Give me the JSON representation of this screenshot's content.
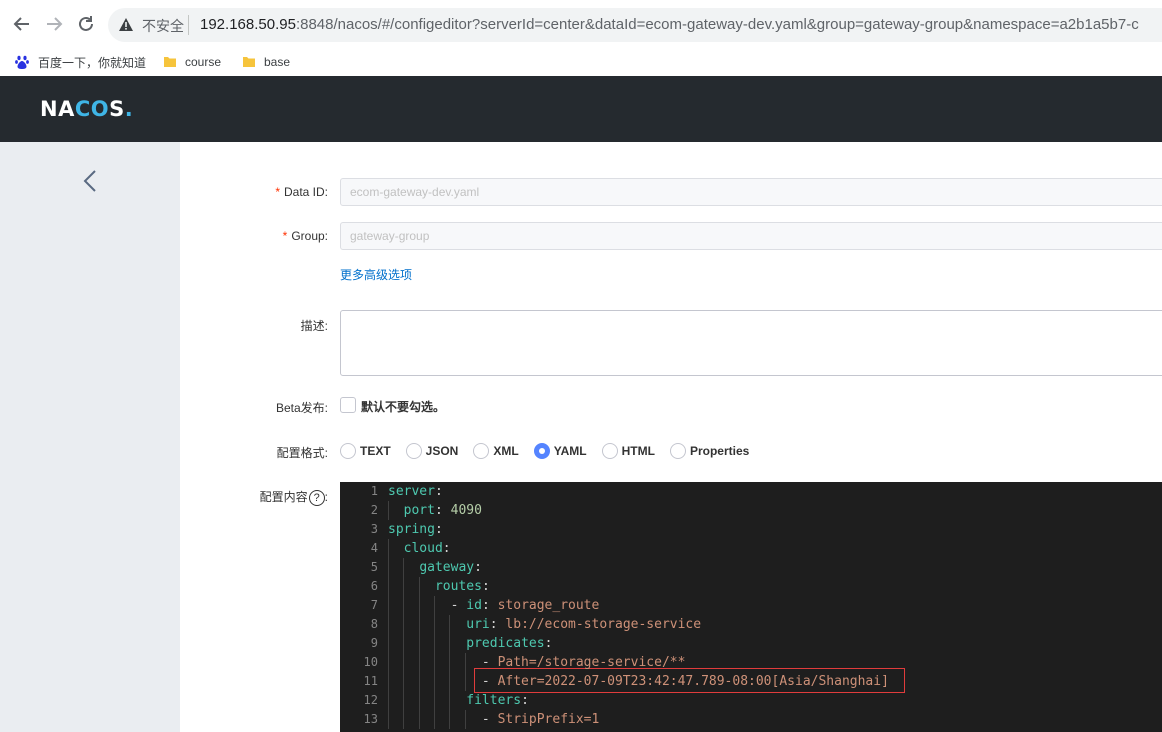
{
  "browser": {
    "security_label": "不安全",
    "url_host": "192.168.50.95",
    "url_rest": ":8848/nacos/#/configeditor?serverId=center&dataId=ecom-gateway-dev.yaml&group=gateway-group&namespace=a2b1a5b7-c",
    "bookmarks": [
      {
        "label": "百度一下，你就知道",
        "icon": "baidu-paw-icon"
      },
      {
        "label": "course",
        "icon": "folder-icon"
      },
      {
        "label": "base",
        "icon": "folder-icon"
      }
    ]
  },
  "app": {
    "logo_parts": [
      "NA",
      "CO",
      "S",
      "."
    ]
  },
  "form": {
    "data_id_label": "Data ID:",
    "data_id_value": "ecom-gateway-dev.yaml",
    "group_label": "Group:",
    "group_value": "gateway-group",
    "advanced_link": "更多高级选项",
    "desc_label": "描述:",
    "beta_label": "Beta发布:",
    "beta_checkbox_label": "默认不要勾选。",
    "format_label": "配置格式:",
    "formats": [
      "TEXT",
      "JSON",
      "XML",
      "YAML",
      "HTML",
      "Properties"
    ],
    "selected_format": "YAML",
    "content_label": "配置内容",
    "help_glyph": "?",
    "required_mark": "*"
  },
  "editor": {
    "line_numbers": [
      "1",
      "2",
      "3",
      "4",
      "5",
      "6",
      "7",
      "8",
      "9",
      "10",
      "11",
      "12",
      "13"
    ],
    "lines": [
      [
        {
          "t": "server",
          "c": "k"
        },
        {
          "t": ":",
          "c": "p"
        }
      ],
      [
        {
          "t": "  ",
          "c": "p"
        },
        {
          "t": "port",
          "c": "k"
        },
        {
          "t": ": ",
          "c": "p"
        },
        {
          "t": "4090",
          "c": "n"
        }
      ],
      [
        {
          "t": "spring",
          "c": "k"
        },
        {
          "t": ":",
          "c": "p"
        }
      ],
      [
        {
          "t": "  ",
          "c": "p"
        },
        {
          "t": "cloud",
          "c": "k"
        },
        {
          "t": ":",
          "c": "p"
        }
      ],
      [
        {
          "t": "    ",
          "c": "p"
        },
        {
          "t": "gateway",
          "c": "k"
        },
        {
          "t": ":",
          "c": "p"
        }
      ],
      [
        {
          "t": "      ",
          "c": "p"
        },
        {
          "t": "routes",
          "c": "k"
        },
        {
          "t": ":",
          "c": "p"
        }
      ],
      [
        {
          "t": "        - ",
          "c": "p"
        },
        {
          "t": "id",
          "c": "k"
        },
        {
          "t": ": ",
          "c": "p"
        },
        {
          "t": "storage_route",
          "c": "s"
        }
      ],
      [
        {
          "t": "          ",
          "c": "p"
        },
        {
          "t": "uri",
          "c": "k"
        },
        {
          "t": ": ",
          "c": "p"
        },
        {
          "t": "lb://ecom-storage-service",
          "c": "s"
        }
      ],
      [
        {
          "t": "          ",
          "c": "p"
        },
        {
          "t": "predicates",
          "c": "k"
        },
        {
          "t": ":",
          "c": "p"
        }
      ],
      [
        {
          "t": "            - ",
          "c": "p"
        },
        {
          "t": "Path=/storage-service/**",
          "c": "s"
        }
      ],
      [
        {
          "t": "            - ",
          "c": "p"
        },
        {
          "t": "After=2022-07-09T23:42:47.789-08:00[Asia/Shanghai]",
          "c": "s"
        }
      ],
      [
        {
          "t": "          ",
          "c": "p"
        },
        {
          "t": "filters",
          "c": "k"
        },
        {
          "t": ":",
          "c": "p"
        }
      ],
      [
        {
          "t": "            - ",
          "c": "p"
        },
        {
          "t": "StripPrefix=1",
          "c": "s"
        }
      ]
    ]
  },
  "colors": {
    "header_bg": "#252a2f",
    "sidebar_bg": "#eaedf1",
    "link": "#0070cc",
    "radio_checked": "#5584ff",
    "editor_bg": "#1e1e1e",
    "highlight_border": "#e03c3c"
  }
}
